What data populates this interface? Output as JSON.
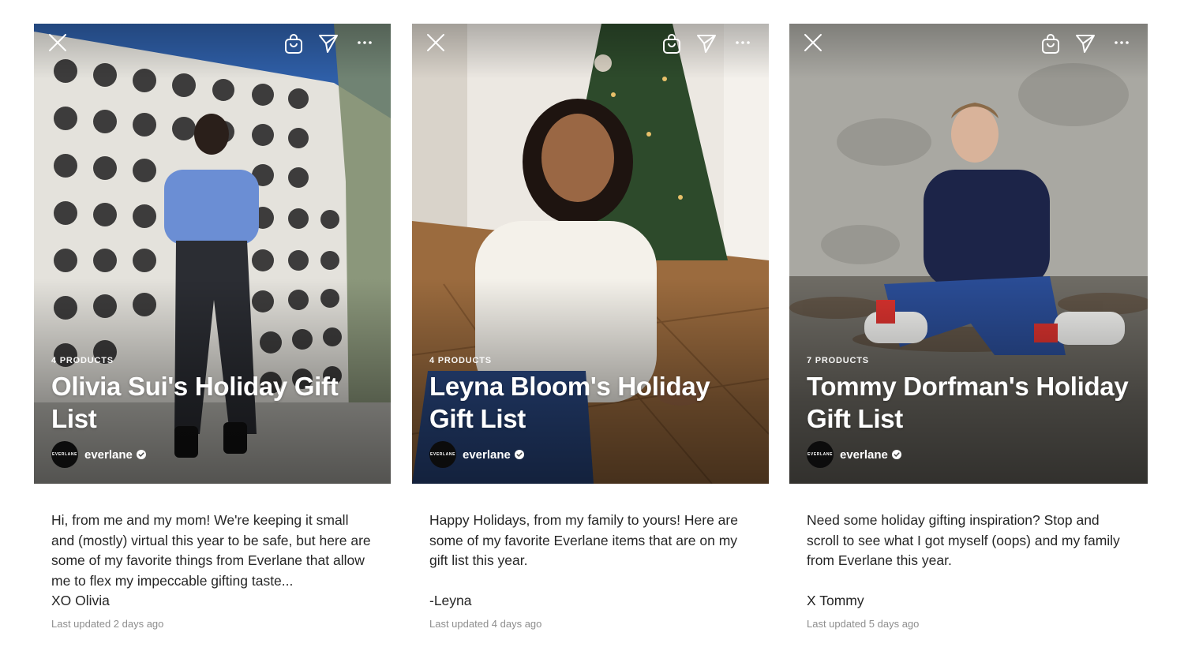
{
  "cards": [
    {
      "product_count": "4 PRODUCTS",
      "title": "Olivia Sui's Holiday Gift List",
      "author": "everlane",
      "avatar_text": "EVERLANE",
      "description": "Hi, from me and my mom!  We're keeping it small and (mostly) virtual this year to be safe, but here are some of my favorite things from Everlane that allow me to flex my impeccable gifting taste...\nXO Olivia",
      "updated": "Last updated 2 days ago",
      "colors": {
        "sky": "#2f5fa8",
        "wall": "#e4e2dc",
        "figure_top": "#6b8ed4"
      }
    },
    {
      "product_count": "4 PRODUCTS",
      "title": "Leyna Bloom's Holiday Gift List",
      "author": "everlane",
      "avatar_text": "EVERLANE",
      "description": "Happy Holidays, from my family to yours! Here are some of my favorite Everlane items that are on my gift list this year.\n\n-Leyna",
      "updated": "Last updated 4 days ago",
      "colors": {
        "wall": "#ece8e2",
        "floor": "#9b6b3e",
        "figure_top": "#f4f1ea"
      }
    },
    {
      "product_count": "7 PRODUCTS",
      "title": "Tommy Dorfman's Holiday Gift List",
      "author": "everlane",
      "avatar_text": "EVERLANE",
      "description": "Need some holiday gifting inspiration? Stop and scroll to see what I got myself (oops) and my family from Everlane this year.\n\nX Tommy",
      "updated": "Last updated 5 days ago",
      "colors": {
        "wall": "#a9a8a2",
        "ground": "#6e6b64",
        "figure_top": "#1c2448"
      }
    }
  ],
  "icons": {
    "close": "close-icon",
    "bag": "shopping-bag-icon",
    "send": "send-icon",
    "more": "more-icon",
    "verified": "verified-badge-icon"
  }
}
